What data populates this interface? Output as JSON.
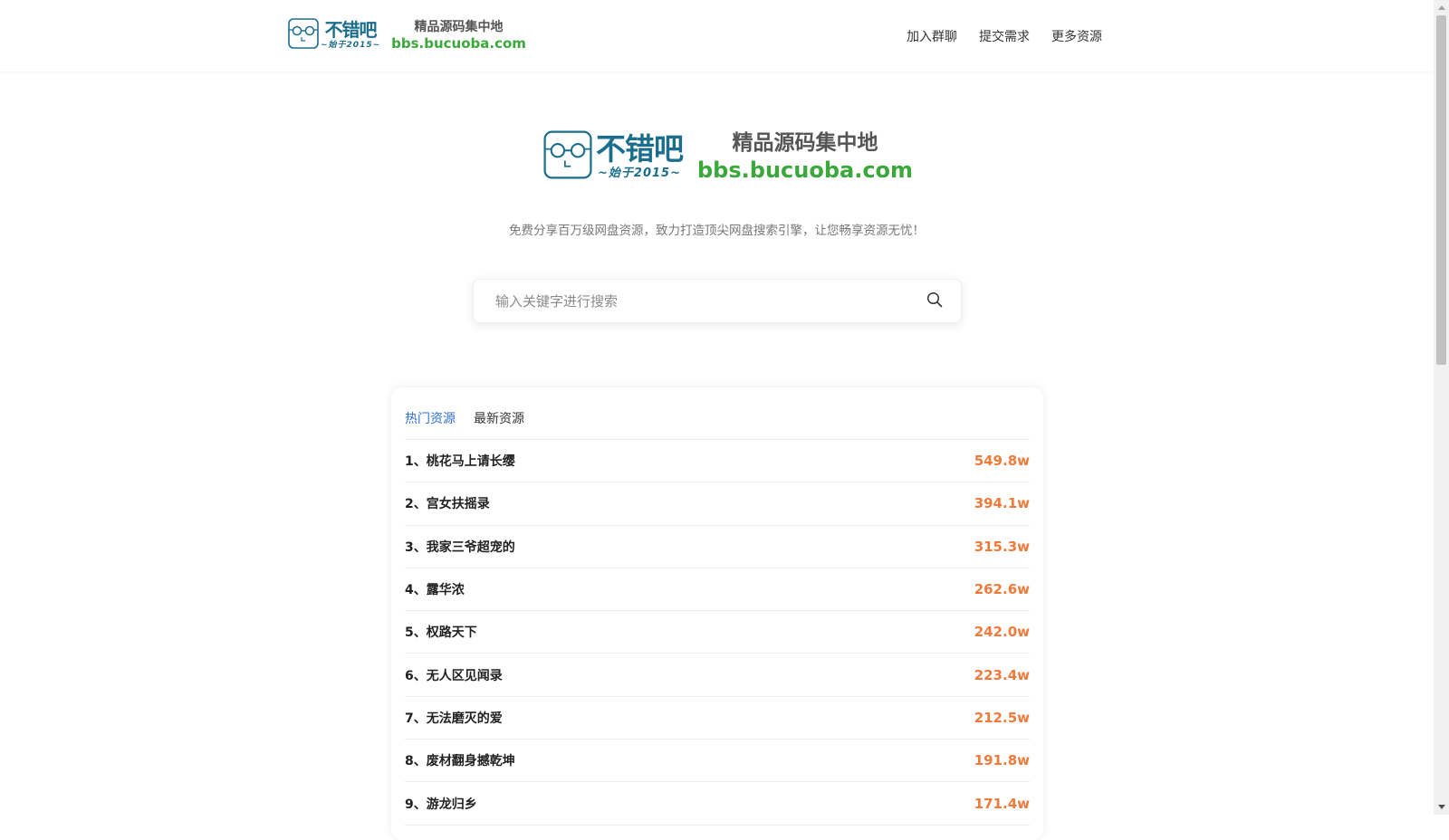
{
  "header": {
    "logo": {
      "wordmark": "不错吧",
      "since": "~始于2015~",
      "tagline": "精品源码集中地",
      "url": "bbs.bucuoba.com"
    },
    "nav": [
      "加入群聊",
      "提交需求",
      "更多资源"
    ]
  },
  "hero": {
    "logo": {
      "wordmark": "不错吧",
      "since": "~始于2015~",
      "tagline": "精品源码集中地",
      "url": "bbs.bucuoba.com"
    },
    "slogan": "免费分享百万级网盘资源，致力打造顶尖网盘搜索引擎，让您畅享资源无忧！",
    "search": {
      "placeholder": "输入关键字进行搜索",
      "icon": "search-icon"
    }
  },
  "tabs": [
    {
      "label": "热门资源",
      "active": true
    },
    {
      "label": "最新资源",
      "active": false
    }
  ],
  "ranking": [
    {
      "title": "1、桃花马上请长缨",
      "count": "549.8w"
    },
    {
      "title": "2、宫女扶摇录",
      "count": "394.1w"
    },
    {
      "title": "3、我家三爷超宠的",
      "count": "315.3w"
    },
    {
      "title": "4、露华浓",
      "count": "262.6w"
    },
    {
      "title": "5、权路天下",
      "count": "242.0w"
    },
    {
      "title": "6、无人区见闻录",
      "count": "223.4w"
    },
    {
      "title": "7、无法磨灭的爱",
      "count": "212.5w"
    },
    {
      "title": "8、废材翻身撼乾坤",
      "count": "191.8w"
    },
    {
      "title": "9、游龙归乡",
      "count": "171.4w"
    }
  ],
  "colors": {
    "brand_teal": "#1a6e8c",
    "url_green": "#3ba83b",
    "tab_active": "#2d6fd6",
    "count_orange": "#f07a3b"
  }
}
